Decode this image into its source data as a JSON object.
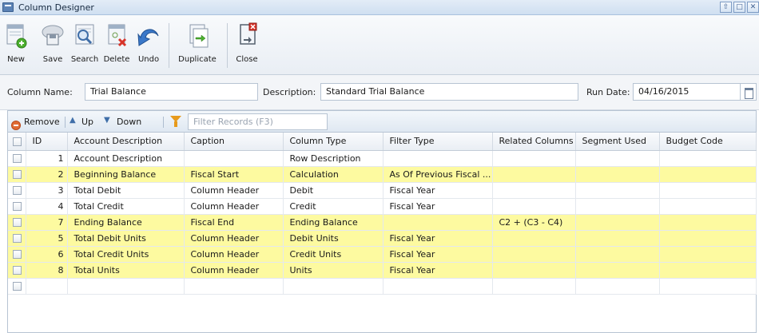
{
  "window": {
    "title": "Column Designer",
    "controls": [
      "restore",
      "maximize",
      "close"
    ]
  },
  "toolbar": {
    "buttons": [
      {
        "label": "New",
        "icon": "new-document-icon"
      },
      {
        "label": "Save",
        "icon": "cloud-save-icon"
      },
      {
        "label": "Search",
        "icon": "search-icon"
      },
      {
        "label": "Delete",
        "icon": "delete-icon"
      },
      {
        "label": "Undo",
        "icon": "undo-icon"
      },
      {
        "label": "Duplicate",
        "icon": "duplicate-icon"
      },
      {
        "label": "Close",
        "icon": "close-icon"
      }
    ]
  },
  "form": {
    "column_name_label": "Column Name:",
    "column_name_value": "Trial Balance",
    "description_label": "Description:",
    "description_value": "Standard Trial Balance",
    "run_date_label": "Run Date:",
    "run_date_value": "04/16/2015"
  },
  "grid_toolbar": {
    "remove": "Remove",
    "up": "Up",
    "down": "Down",
    "filter_placeholder": "Filter Records (F3)"
  },
  "grid": {
    "columns": [
      "ID",
      "Account Description",
      "Caption",
      "Column Type",
      "Filter Type",
      "Related Columns",
      "Segment Used",
      "Budget Code"
    ],
    "rows": [
      {
        "id": "1",
        "description": "Account Description",
        "caption": "",
        "type": "Row Description",
        "filter": "",
        "related": "",
        "segment": "",
        "budget": "",
        "highlight": false
      },
      {
        "id": "2",
        "description": "Beginning Balance",
        "caption": "Fiscal Start",
        "type": "Calculation",
        "filter": "As Of Previous Fiscal ...",
        "related": "",
        "segment": "",
        "budget": "",
        "highlight": true
      },
      {
        "id": "3",
        "description": "Total Debit",
        "caption": "Column Header",
        "type": "Debit",
        "filter": "Fiscal Year",
        "related": "",
        "segment": "",
        "budget": "",
        "highlight": false
      },
      {
        "id": "4",
        "description": "Total Credit",
        "caption": "Column Header",
        "type": "Credit",
        "filter": "Fiscal Year",
        "related": "",
        "segment": "",
        "budget": "",
        "highlight": false
      },
      {
        "id": "7",
        "description": "Ending Balance",
        "caption": "Fiscal End",
        "type": "Ending Balance",
        "filter": "",
        "related": "C2 + (C3 - C4)",
        "segment": "",
        "budget": "",
        "highlight": true
      },
      {
        "id": "5",
        "description": "Total Debit Units",
        "caption": "Column Header",
        "type": "Debit Units",
        "filter": "Fiscal Year",
        "related": "",
        "segment": "",
        "budget": "",
        "highlight": true
      },
      {
        "id": "6",
        "description": "Total Credit Units",
        "caption": "Column Header",
        "type": "Credit Units",
        "filter": "Fiscal Year",
        "related": "",
        "segment": "",
        "budget": "",
        "highlight": true
      },
      {
        "id": "8",
        "description": "Total Units",
        "caption": "Column Header",
        "type": "Units",
        "filter": "Fiscal Year",
        "related": "",
        "segment": "",
        "budget": "",
        "highlight": true
      },
      {
        "id": "",
        "description": "",
        "caption": "",
        "type": "",
        "filter": "",
        "related": "",
        "segment": "",
        "budget": "",
        "highlight": false
      }
    ]
  },
  "colors": {
    "highlight_row": "#fdfaa0",
    "accent": "#3d5f91",
    "remove_icon": "#e06b34",
    "filter_icon": "#e79a1c"
  }
}
